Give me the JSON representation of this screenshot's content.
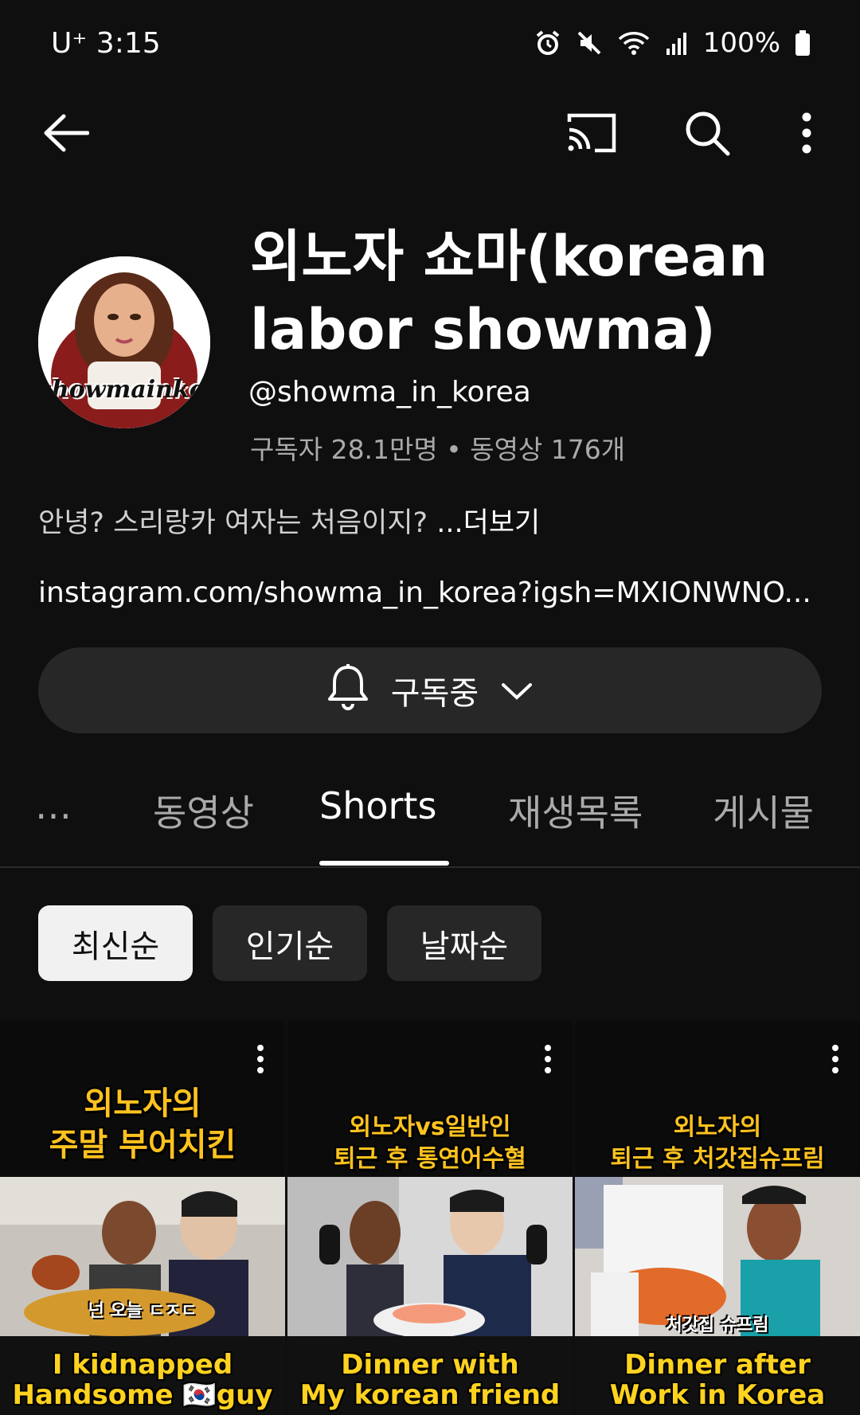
{
  "status_bar": {
    "time": "U⁺ 3:15",
    "battery": "100%",
    "icons": [
      "alarm-icon",
      "mute-icon",
      "wifi-icon",
      "signal-icon",
      "battery-icon"
    ]
  },
  "top_bar": {
    "icons": [
      "back-arrow-icon",
      "cast-icon",
      "search-icon",
      "more-vert-icon"
    ]
  },
  "channel": {
    "title": "외노자 쇼마(korean labor showma)",
    "handle": "@showma_in_korea",
    "stats": "구독자 28.1만명 • 동영상 176개",
    "description": "안녕? 스리랑카 여자는 처음이지?",
    "more_label": "...더보기",
    "link": "instagram.com/showma_in_korea?igsh=MXIONWNO...",
    "avatar_text": "showmainkorea"
  },
  "subscribe": {
    "label": "구독중"
  },
  "tabs": [
    {
      "label": "…"
    },
    {
      "label": "동영상"
    },
    {
      "label": "Shorts"
    },
    {
      "label": "재생목록"
    },
    {
      "label": "게시물"
    }
  ],
  "active_tab": "Shorts",
  "chips": [
    {
      "label": "최신순",
      "selected": true
    },
    {
      "label": "인기순",
      "selected": false
    },
    {
      "label": "날짜순",
      "selected": false
    }
  ],
  "shorts": [
    {
      "headline": "외노자의\n주말 부어치킨",
      "overlay": "넌 오늘 ㄷㅈㄷ",
      "caption": "I kidnapped\nHandsome 🇰🇷guy"
    },
    {
      "headline": "외노자vs일반인\n퇴근 후 통연어수혈",
      "overlay": "",
      "caption": "Dinner with\nMy korean friend"
    },
    {
      "headline": "외노자의\n퇴근 후 처갓집슈프림",
      "overlay": "처갓집 슈프림",
      "caption": "Dinner after\nWork in Korea"
    }
  ],
  "colors": {
    "background": "#0f0f0f",
    "chip_bg": "#272727",
    "chip_selected_bg": "#f1f1f1",
    "headline_yellow": "#ffc21f"
  }
}
